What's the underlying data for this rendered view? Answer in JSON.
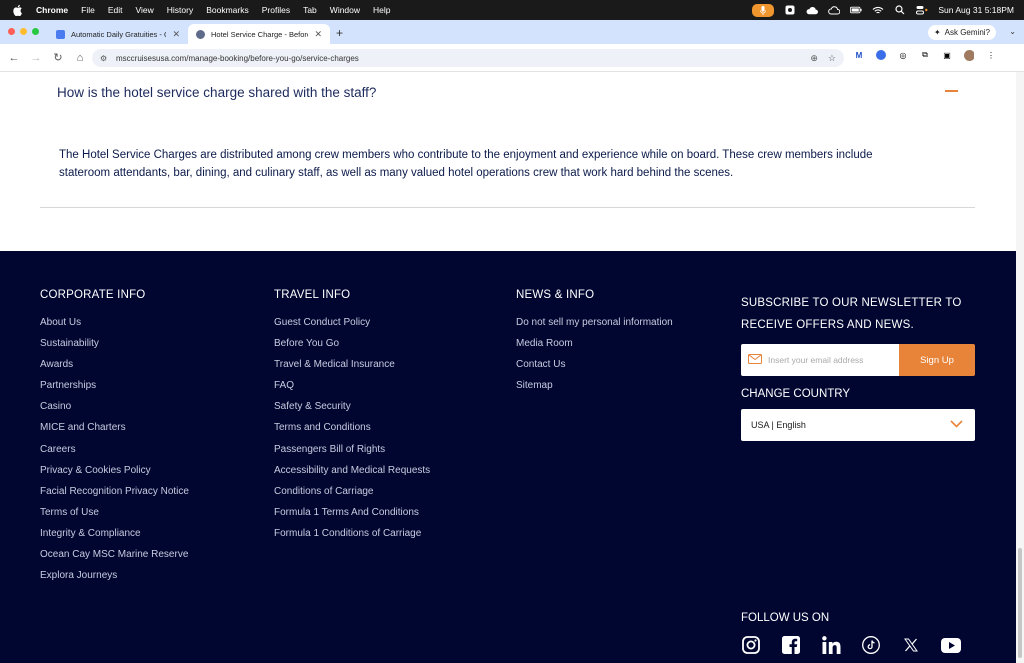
{
  "menubar": {
    "app": "Chrome",
    "items": [
      "File",
      "Edit",
      "View",
      "History",
      "Bookmarks",
      "Profiles",
      "Tab",
      "Window",
      "Help"
    ],
    "datetime": "Sun Aug 31  5:18PM"
  },
  "tabs": [
    {
      "title": "Automatic Daily Gratuities - G",
      "favicon_color": "#4a7cf0"
    },
    {
      "title": "Hotel Service Charge - Before",
      "favicon_color": "#5f6b8a"
    }
  ],
  "gemini_label": "Ask Gemini?",
  "address": {
    "url": "msccruisesusa.com/manage-booking/before-you-go/service-charges"
  },
  "faq": {
    "question": "How is the hotel service charge shared with the staff?",
    "answer_line1": "The Hotel Service Charges are distributed among crew members who contribute to the enjoyment and experience while on board. These crew members include",
    "answer_line2": "stateroom attendants, bar, dining, and culinary staff, as well as many valued hotel operations crew that work hard behind the scenes."
  },
  "footer": {
    "corporate": {
      "heading": "CORPORATE INFO",
      "links": [
        "About Us",
        "Sustainability",
        "Awards",
        "Partnerships",
        "Casino",
        "MICE and Charters",
        "Careers",
        "Privacy & Cookies Policy",
        "Facial Recognition Privacy Notice",
        "Terms of Use",
        "Integrity & Compliance",
        "Ocean Cay MSC Marine Reserve",
        "Explora Journeys"
      ]
    },
    "travel": {
      "heading": "TRAVEL INFO",
      "links": [
        "Guest Conduct Policy",
        "Before You Go",
        "Travel & Medical Insurance",
        "FAQ",
        "Safety & Security",
        "Terms and Conditions",
        "Passengers Bill of Rights",
        "Accessibility and Medical Requests",
        "Conditions of Carriage",
        "Formula 1 Terms And Conditions",
        "Formula 1 Conditions of Carriage"
      ]
    },
    "news": {
      "heading": "NEWS & INFO",
      "links": [
        "Do not sell my personal information",
        "Media Room",
        "Contact Us",
        "Sitemap"
      ]
    },
    "newsletter": {
      "heading": "SUBSCRIBE TO OUR NEWSLETTER TO RECEIVE OFFERS AND NEWS.",
      "placeholder": "Insert your email address",
      "button": "Sign Up"
    },
    "country": {
      "heading": "CHANGE COUNTRY",
      "selected": "USA | English"
    },
    "follow": {
      "heading": "FOLLOW US ON"
    }
  },
  "colors": {
    "accent": "#e8843a",
    "footer_bg": "#000630",
    "text_dark": "#1d2a5d"
  }
}
